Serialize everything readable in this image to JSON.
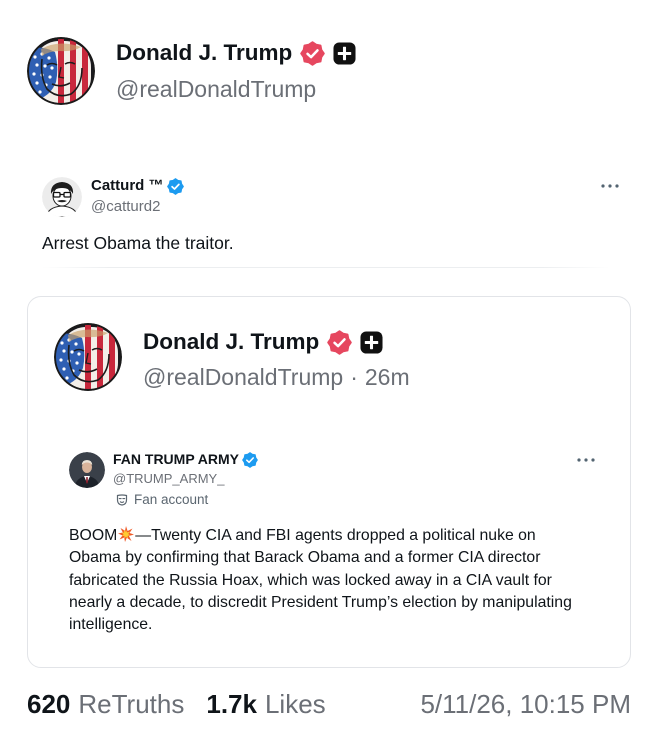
{
  "colors": {
    "text": "#0f1419",
    "muted": "#6b6f76",
    "muted_2": "#5b6670",
    "pink_badge": "#e6475f",
    "blue_badge": "#1d9bf0",
    "card_border": "#e2e4e8",
    "divider": "#eceef0",
    "dots": "#536471"
  },
  "post": {
    "author": {
      "name": "Donald J. Trump",
      "handle": "@realDonaldTrump",
      "avatar_icon": "trump-flag-avatar",
      "verified_icon": "pink-verified-badge-icon",
      "plus_icon": "truth-plus-badge-icon"
    },
    "quoted_post": {
      "author": {
        "name": "Catturd ™",
        "handle": "@catturd2",
        "avatar_icon": "catturd-cartoon-avatar",
        "verified_icon": "blue-verified-badge-icon"
      },
      "more_icon": "more-dots-icon",
      "text": "Arrest Obama the traitor."
    },
    "retruth_card": {
      "author": {
        "name": "Donald J. Trump",
        "handle": "@realDonaldTrump",
        "separator": "·",
        "time": "26m",
        "avatar_icon": "trump-flag-avatar",
        "verified_icon": "pink-verified-badge-icon",
        "plus_icon": "truth-plus-badge-icon"
      },
      "quoted_post": {
        "author": {
          "name": "FAN TRUMP ARMY",
          "handle": "@TRUMP_ARMY_",
          "account_label": "Fan account",
          "label_icon": "fan-account-mask-icon",
          "avatar_icon": "fan-trump-army-avatar",
          "verified_icon": "blue-verified-badge-icon"
        },
        "more_icon": "more-dots-icon",
        "body": {
          "lead": "BOOM",
          "emoji_icon": "collision-emoji-icon",
          "lines": [
            "—Twenty CIA and FBI agents dropped a political nuke on",
            "Obama by confirming that Barack Obama and a former CIA director",
            "fabricated the Russia Hoax, which was locked away in a CIA vault for",
            "nearly a decade, to discredit President Trump’s election by manipulating",
            "intelligence."
          ]
        }
      }
    },
    "stats": {
      "retruths_count": "620",
      "retruths_label": "ReTruths",
      "likes_count": "1.7k",
      "likes_label": "Likes",
      "timestamp": "5/11/26, 10:15 PM"
    }
  }
}
